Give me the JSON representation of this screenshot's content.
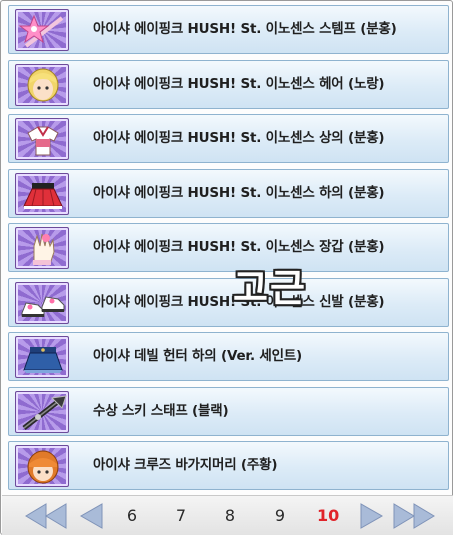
{
  "items": [
    {
      "label": "아이샤 에이핑크 HUSH! St. 이노센스 스템프 (분홍)",
      "icon": "pink-staff-icon"
    },
    {
      "label": "아이샤 에이핑크 HUSH! St. 이노센스 헤어 (노랑)",
      "icon": "yellow-hair-icon"
    },
    {
      "label": "아이샤 에이핑크 HUSH! St. 이노센스 상의 (분홍)",
      "icon": "pink-top-icon"
    },
    {
      "label": "아이샤 에이핑크 HUSH! St. 이노센스 하의 (분홍)",
      "icon": "pink-skirt-icon"
    },
    {
      "label": "아이샤 에이핑크 HUSH! St. 이노센스 장갑 (분홍)",
      "icon": "glove-icon"
    },
    {
      "label": "아이샤 에이핑크 HUSH! St. 이노센스 신발 (분홍)",
      "icon": "shoes-icon"
    },
    {
      "label": "아이샤 데빌 헌터 하의 (Ver. 세인트)",
      "icon": "blue-skirt-icon"
    },
    {
      "label": "수상 스키 스태프 (블랙)",
      "icon": "black-staff-icon"
    },
    {
      "label": "아이샤 크루즈 바가지머리 (주황)",
      "icon": "orange-hair-icon"
    }
  ],
  "watermark": "고근",
  "pager": {
    "pages": [
      "6",
      "7",
      "8",
      "9",
      "10"
    ],
    "current": "10"
  },
  "colors": {
    "current_page": "#e0242a",
    "item_border": "#8fb3cf",
    "thumb_bg": "#8f6bd0"
  }
}
